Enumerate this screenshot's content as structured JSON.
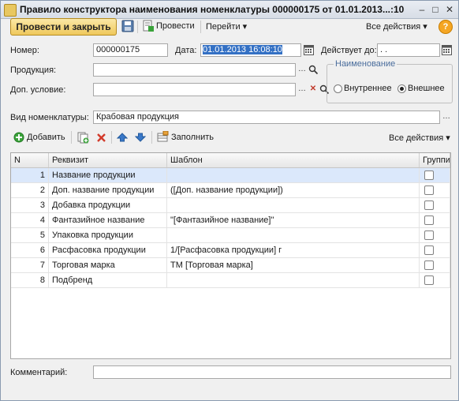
{
  "window": {
    "title": "Правило конструктора наименования номенклатуры 000000175 от 01.01.2013...:10",
    "min_glyph": "–",
    "max_glyph": "□",
    "close_glyph": "✕"
  },
  "toolbar": {
    "post_and_close_label": "Провести и закрыть",
    "post_label": "Провести",
    "goto_label": "Перейти",
    "all_actions_label": "Все действия",
    "dropdown_glyph": "▾",
    "help_glyph": "?"
  },
  "form": {
    "number_label": "Номер:",
    "number_value": "000000175",
    "date_label": "Дата:",
    "date_value": "01.01.2013 16:08:10",
    "valid_until_label": "Действует до:",
    "valid_until_value": ". .",
    "product_label": "Продукция:",
    "product_value": "",
    "extra_condition_label": "Доп. условие:",
    "extra_condition_value": "",
    "name_group_title": "Наименование",
    "radio_internal_label": "Внутреннее",
    "radio_external_label": "Внешнее",
    "radio_selected": "external",
    "nomenclature_type_label": "Вид номенклатуры:",
    "nomenclature_type_value": "Крабовая продукция",
    "comment_label": "Комментарий:",
    "comment_value": ""
  },
  "table_toolbar": {
    "add_label": "Добавить",
    "fill_label": "Заполнить",
    "all_actions_label": "Все действия"
  },
  "table": {
    "columns": [
      "N",
      "Реквизит",
      "Шаблон",
      "Группир"
    ],
    "rows": [
      {
        "n": "1",
        "attr": "Название продукции",
        "template": "",
        "group": false
      },
      {
        "n": "2",
        "attr": "Доп. название продукции",
        "template": "([Доп. название продукции])",
        "group": false
      },
      {
        "n": "3",
        "attr": "Добавка продукции",
        "template": "",
        "group": false
      },
      {
        "n": "4",
        "attr": "Фантазийное название",
        "template": "\"[Фантазийное название]\"",
        "group": false
      },
      {
        "n": "5",
        "attr": "Упаковка продукции",
        "template": "",
        "group": false
      },
      {
        "n": "6",
        "attr": "Расфасовка продукции",
        "template": "1/[Расфасовка продукции] г",
        "group": false
      },
      {
        "n": "7",
        "attr": "Торговая марка",
        "template": "ТМ [Торговая марка]",
        "group": false
      },
      {
        "n": "8",
        "attr": "Подбренд",
        "template": "",
        "group": false
      }
    ],
    "selected_row": 0
  },
  "colors": {
    "accent_button": "#efc85c",
    "selected_row": "#dbe8fb",
    "group_title": "#4a6d9c",
    "delete_icon": "#d23a2a",
    "arrow_icon": "#3a78c8",
    "add_icon": "#3aa33a"
  }
}
